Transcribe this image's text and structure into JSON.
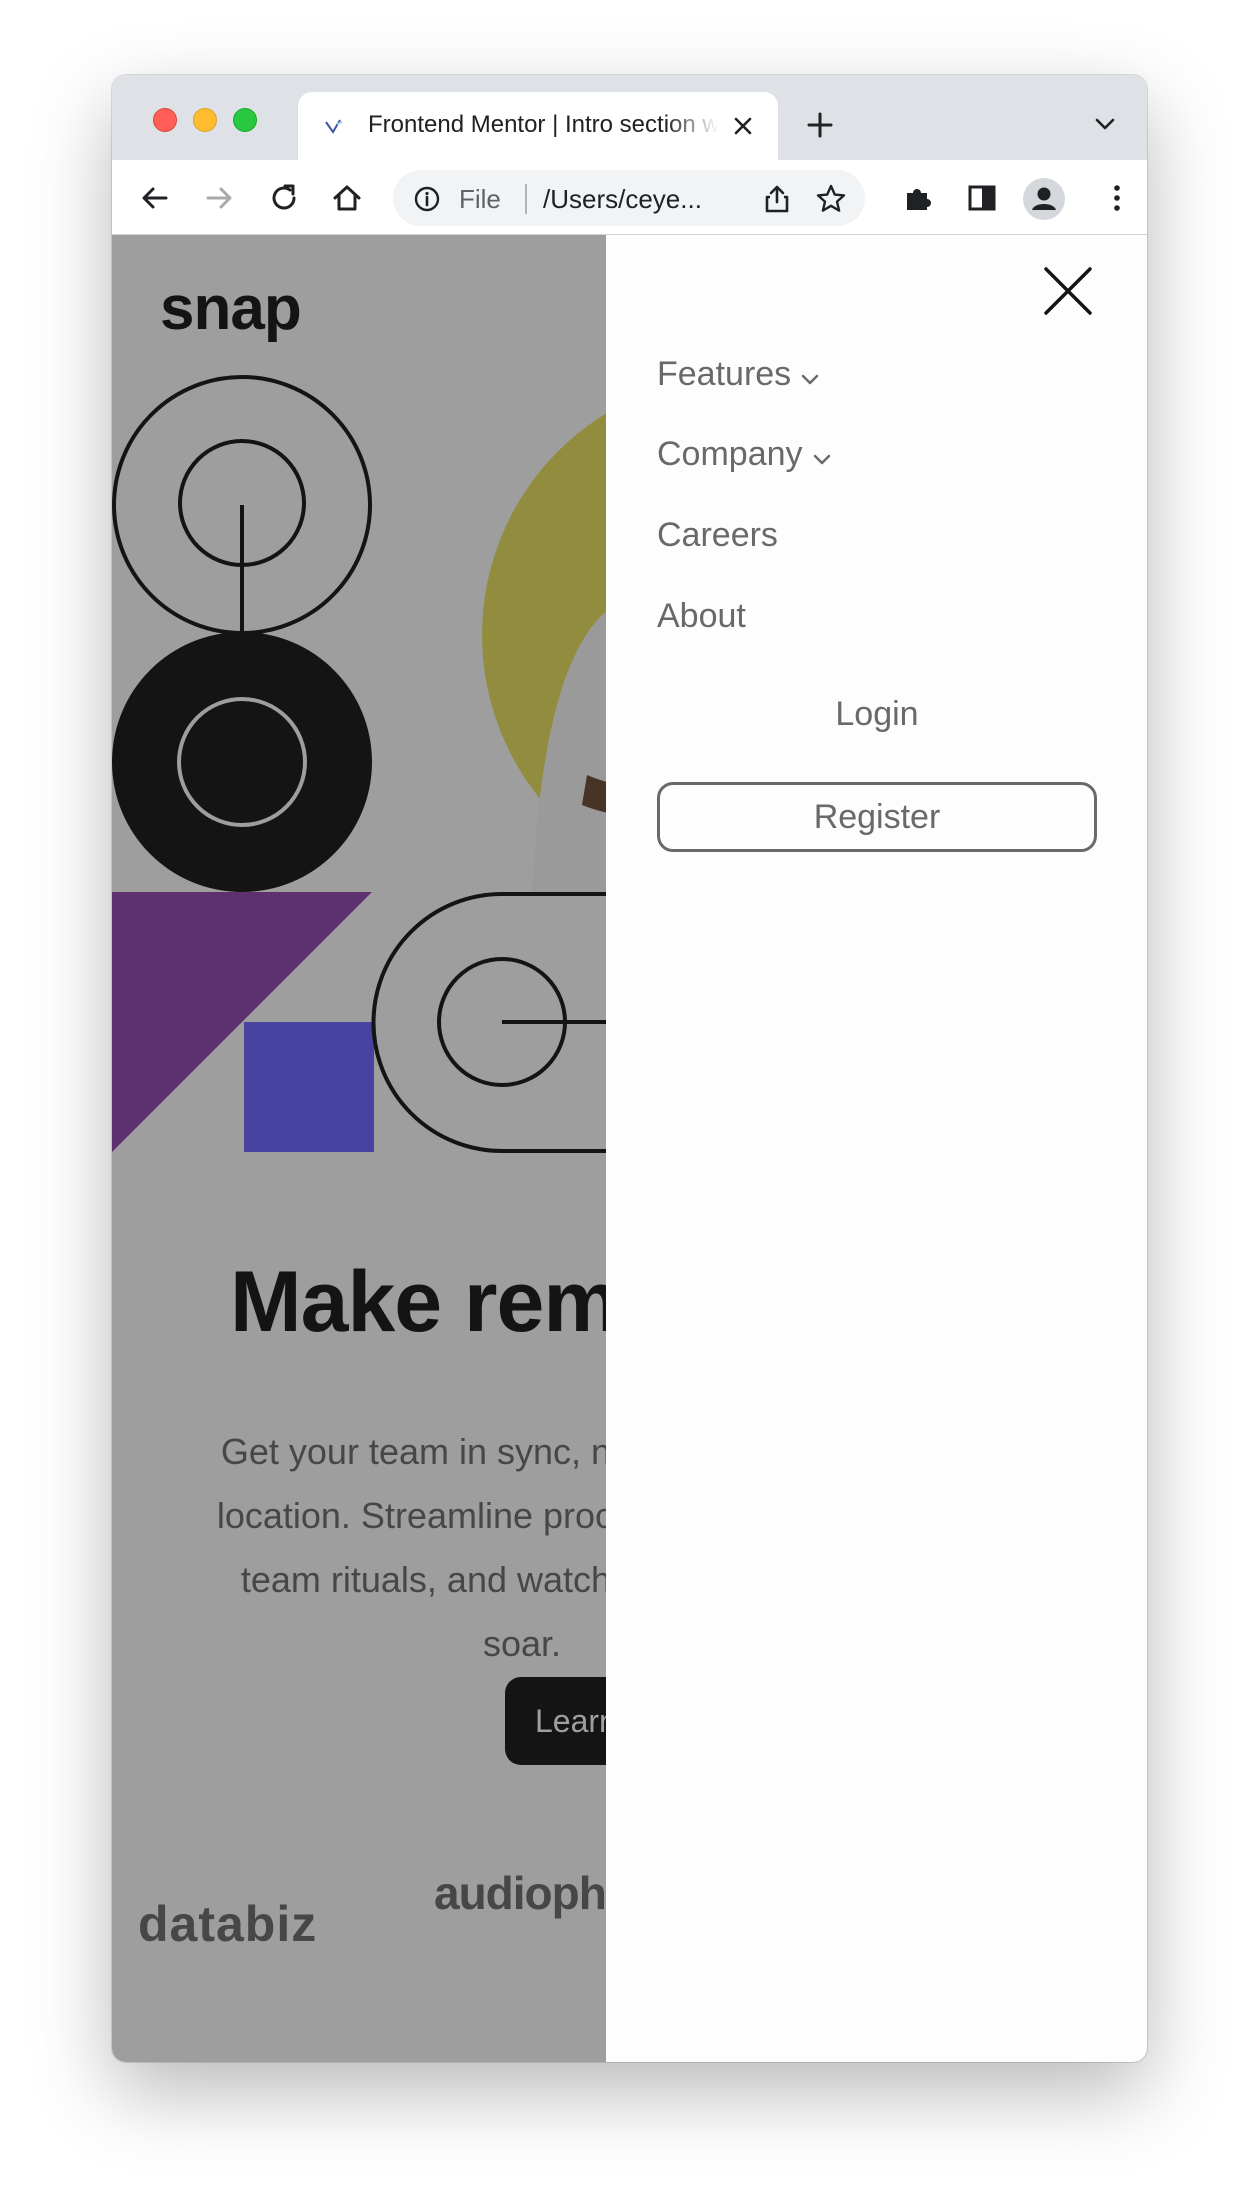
{
  "browser": {
    "tab_title": "Frontend Mentor | Intro section with dropdown navigation",
    "new_tab_icon": "plus-icon",
    "omnibox_scheme": "File",
    "omnibox_url": "/Users/ceye...",
    "toolbar_icons": [
      "back-arrow-icon",
      "forward-arrow-icon",
      "reload-icon",
      "home-icon",
      "info-icon",
      "share-icon",
      "bookmark-star-icon",
      "extensions-puzzle-icon",
      "side-panel-icon",
      "profile-icon",
      "kebab-menu-icon"
    ]
  },
  "page": {
    "logo": "snap",
    "hero_title": "Make remote work",
    "hero_paragraph": "Get your team in sync, no matter your location. Streamline processes, create team rituals, and watch productivity soar.",
    "cta_label": "Learn more",
    "clients": [
      "databiz",
      "audiophile"
    ]
  },
  "menu": {
    "items": [
      {
        "label": "Features",
        "has_dropdown": true
      },
      {
        "label": "Company",
        "has_dropdown": true
      },
      {
        "label": "Careers",
        "has_dropdown": false
      },
      {
        "label": "About",
        "has_dropdown": false
      }
    ],
    "login_label": "Login",
    "register_label": "Register"
  },
  "colors": {
    "almost_black": "#141414",
    "medium_gray": "#696969",
    "almost_white": "#fafafa",
    "hero_yellow": "#e5dd5a",
    "shape_purple": "#8e44ad",
    "shape_blue": "#6c63ff"
  }
}
